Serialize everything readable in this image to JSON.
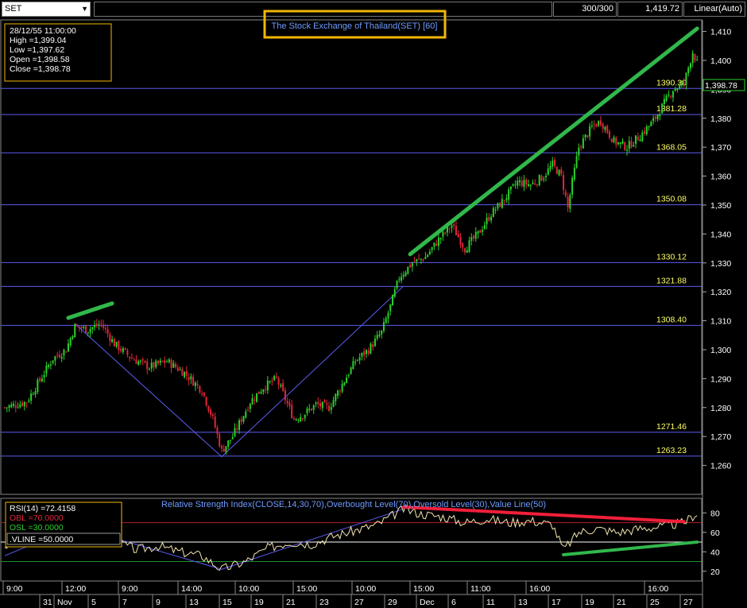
{
  "toolbar": {
    "symbol": "SET",
    "bars": "300/300",
    "last": "1,419.72",
    "scale_mode": "Linear(Auto)"
  },
  "chart_title": "The Stock Exchange of Thailand(SET) [60]",
  "ohlc_box": {
    "datetime": "28/12/55 11:00:00",
    "high": "High =1,399.04",
    "low": "Low =1,397.62",
    "open": "Open =1,398.58",
    "close": "Close =1,398.78"
  },
  "last_price_tag": "1,398.78",
  "rsi_box": {
    "rsi": "RSI(14)  =72.4158",
    "obl": "OBL  =70.0000",
    "osl": "OSL  =30.0000",
    "vline": ".VLINE  =50.0000"
  },
  "rsi_title": "Relative Strength Index(CLOSE,14,30,70),Overbought Level(70),Oversold Level(30),Value Line(50)",
  "colors": {
    "up": "#2bd12b",
    "down": "#e0263a",
    "level_line": "#5c5cf0",
    "trend": "#31b84b",
    "rsi_trend_down": "#f01f3a",
    "title_box": "#f2b705"
  },
  "chart_data": [
    {
      "type": "candlestick",
      "title": "The Stock Exchange of Thailand(SET) [60]",
      "ylim": [
        1250,
        1414
      ],
      "y_ticks": [
        1260,
        1270,
        1280,
        1290,
        1300,
        1310,
        1320,
        1330,
        1340,
        1350,
        1360,
        1370,
        1380,
        1390,
        1400,
        1410
      ],
      "horizontal_levels": [
        1390.3,
        1381.28,
        1368.05,
        1350.08,
        1330.12,
        1321.88,
        1308.4,
        1271.46,
        1263.23
      ],
      "waypoints": [
        [
          0,
          1280
        ],
        [
          10,
          1282
        ],
        [
          22,
          1297
        ],
        [
          28,
          1300
        ],
        [
          32,
          1308
        ],
        [
          38,
          1307
        ],
        [
          44,
          1309
        ],
        [
          50,
          1302
        ],
        [
          58,
          1297
        ],
        [
          66,
          1294
        ],
        [
          74,
          1296
        ],
        [
          82,
          1292
        ],
        [
          90,
          1286
        ],
        [
          95,
          1276
        ],
        [
          99,
          1265
        ],
        [
          104,
          1270
        ],
        [
          112,
          1282
        ],
        [
          118,
          1287
        ],
        [
          124,
          1290
        ],
        [
          128,
          1283
        ],
        [
          132,
          1276
        ],
        [
          137,
          1278
        ],
        [
          142,
          1281
        ],
        [
          148,
          1280
        ],
        [
          154,
          1288
        ],
        [
          160,
          1296
        ],
        [
          166,
          1300
        ],
        [
          172,
          1306
        ],
        [
          176,
          1315
        ],
        [
          180,
          1325
        ],
        [
          186,
          1330
        ],
        [
          192,
          1332
        ],
        [
          198,
          1338
        ],
        [
          204,
          1343
        ],
        [
          210,
          1335
        ],
        [
          216,
          1340
        ],
        [
          222,
          1347
        ],
        [
          228,
          1352
        ],
        [
          234,
          1358
        ],
        [
          240,
          1357
        ],
        [
          246,
          1360
        ],
        [
          250,
          1364
        ],
        [
          254,
          1360
        ],
        [
          257,
          1349
        ],
        [
          259,
          1358
        ],
        [
          262,
          1370
        ],
        [
          268,
          1377
        ],
        [
          272,
          1379
        ],
        [
          278,
          1372
        ],
        [
          284,
          1370
        ],
        [
          290,
          1374
        ],
        [
          296,
          1379
        ],
        [
          300,
          1384
        ],
        [
          305,
          1390
        ],
        [
          310,
          1392
        ],
        [
          314,
          1403
        ],
        [
          316,
          1399
        ]
      ],
      "trendlines": [
        {
          "from": [
            29,
            1311
          ],
          "to": [
            49,
            1316
          ]
        },
        {
          "from": [
            185,
            1333
          ],
          "to": [
            316,
            1411
          ]
        }
      ],
      "zigzag": [
        [
          32,
          1309
        ],
        [
          99,
          1263
        ],
        [
          182,
          1322
        ]
      ],
      "x_time_labels": [
        "9:00",
        "12:00",
        "9:00",
        "14:00",
        "10:00",
        "15:00",
        "10:00",
        "15:00",
        "11:00",
        "16:00",
        "16:00"
      ],
      "x_date_labels": [
        "31",
        "Nov",
        "5",
        "7",
        "9",
        "13",
        "15",
        "19",
        "21",
        "23",
        "27",
        "29",
        "Dec",
        "6",
        "11",
        "13",
        "17",
        "19",
        "21",
        "25",
        "27"
      ]
    },
    {
      "type": "line",
      "title": "Relative Strength Index(CLOSE,14,30,70),Overbought Level(70),Oversold Level(30),Value Line(50)",
      "ylim": [
        10,
        95
      ],
      "y_ticks": [
        20,
        40,
        60,
        80
      ],
      "levels": {
        "overbought": 70,
        "oversold": 30,
        "value": 50
      },
      "waypoints": [
        [
          0,
          46
        ],
        [
          20,
          58
        ],
        [
          32,
          66
        ],
        [
          40,
          58
        ],
        [
          50,
          52
        ],
        [
          60,
          42
        ],
        [
          70,
          46
        ],
        [
          80,
          40
        ],
        [
          90,
          36
        ],
        [
          99,
          22
        ],
        [
          110,
          30
        ],
        [
          120,
          44
        ],
        [
          130,
          50
        ],
        [
          140,
          48
        ],
        [
          150,
          56
        ],
        [
          160,
          62
        ],
        [
          170,
          68
        ],
        [
          182,
          84
        ],
        [
          190,
          79
        ],
        [
          200,
          76
        ],
        [
          210,
          70
        ],
        [
          220,
          74
        ],
        [
          230,
          70
        ],
        [
          240,
          72
        ],
        [
          250,
          68
        ],
        [
          255,
          42
        ],
        [
          262,
          60
        ],
        [
          270,
          64
        ],
        [
          280,
          60
        ],
        [
          290,
          64
        ],
        [
          300,
          66
        ],
        [
          310,
          70
        ],
        [
          316,
          80
        ]
      ],
      "trendlines": [
        {
          "from": [
            182,
            86
          ],
          "to": [
            310,
            71
          ]
        },
        {
          "from": [
            255,
            37
          ],
          "to": [
            316,
            50
          ]
        }
      ]
    }
  ]
}
